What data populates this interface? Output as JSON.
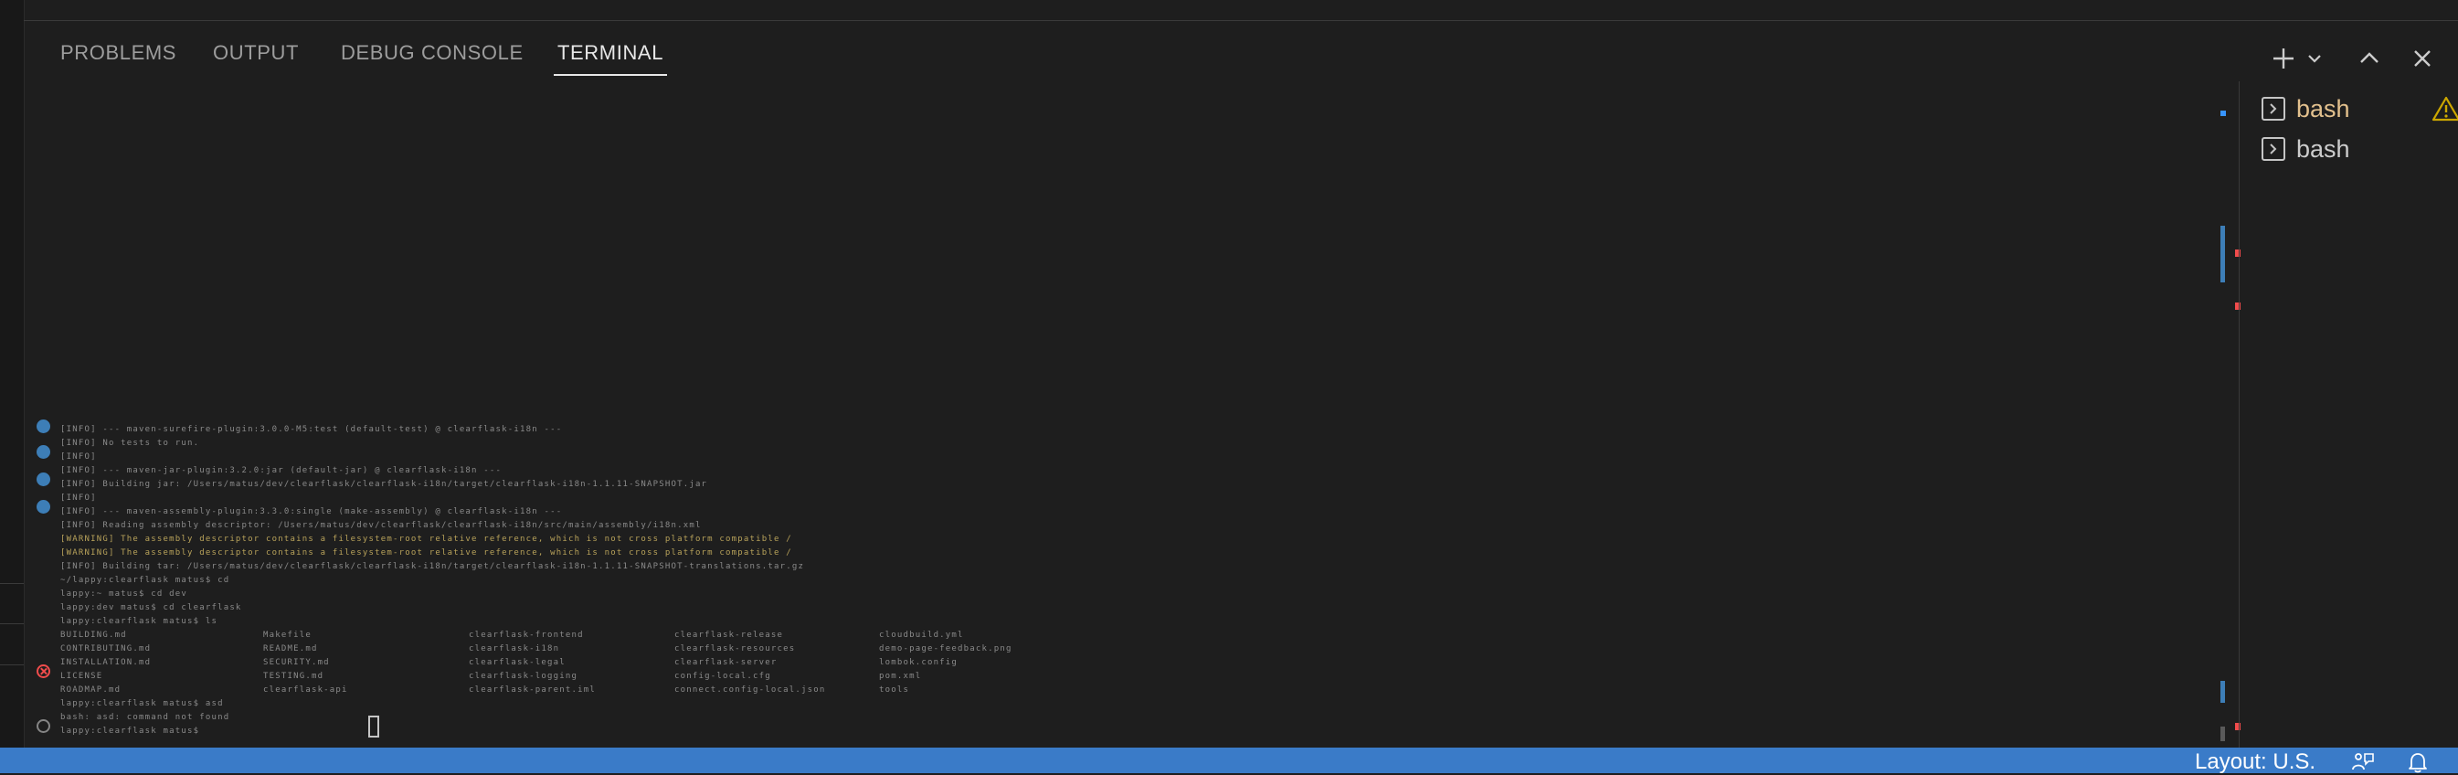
{
  "panel": {
    "tabs": [
      {
        "label": "PROBLEMS"
      },
      {
        "label": "OUTPUT"
      },
      {
        "label": "DEBUG CONSOLE"
      },
      {
        "label": "TERMINAL"
      }
    ],
    "active_tab": "TERMINAL",
    "actions": [
      "plus-icon",
      "chevron-down-icon",
      "chevron-up-icon",
      "close-icon"
    ]
  },
  "terminal": {
    "lines": [
      {
        "text": "[INFO] --- maven-surefire-plugin:3.0.0-M5:test (default-test) @ clearflask-i18n ---",
        "level": "info"
      },
      {
        "text": "[INFO] No tests to run.",
        "level": "info"
      },
      {
        "text": "[INFO]",
        "level": "info"
      },
      {
        "text": "[INFO] --- maven-jar-plugin:3.2.0:jar (default-jar) @ clearflask-i18n ---",
        "level": "info"
      },
      {
        "text": "[INFO] Building jar: /Users/matus/dev/clearflask/clearflask-i18n/target/clearflask-i18n-1.1.11-SNAPSHOT.jar",
        "level": "info"
      },
      {
        "text": "[INFO]",
        "level": "info"
      },
      {
        "text": "[INFO] --- maven-assembly-plugin:3.3.0:single (make-assembly) @ clearflask-i18n ---",
        "level": "info"
      },
      {
        "text": "[INFO] Reading assembly descriptor: /Users/matus/dev/clearflask/clearflask-i18n/src/main/assembly/i18n.xml",
        "level": "info"
      },
      {
        "text": "[WARNING] The assembly descriptor contains a filesystem-root relative reference, which is not cross platform compatible /",
        "level": "warn"
      },
      {
        "text": "[WARNING] The assembly descriptor contains a filesystem-root relative reference, which is not cross platform compatible /",
        "level": "warn"
      },
      {
        "text": "[INFO] Building tar: /Users/matus/dev/clearflask/clearflask-i18n/target/clearflask-i18n-1.1.11-SNAPSHOT-translations.tar.gz",
        "level": "info"
      },
      {
        "text": "~/lappy:clearflask matus$ cd",
        "level": "plain"
      },
      {
        "text": "lappy:~ matus$ cd dev",
        "level": "plain"
      },
      {
        "text": "lappy:dev matus$ cd clearflask",
        "level": "plain"
      },
      {
        "text": "lappy:clearflask matus$ ls",
        "level": "plain"
      },
      {
        "text": "BUILDING.md",
        "level": "plain"
      },
      {
        "text": "CONTRIBUTING.md",
        "level": "plain"
      },
      {
        "text": "INSTALLATION.md",
        "level": "plain"
      },
      {
        "text": "lappy:clearflask matus$ asd",
        "level": "plain"
      },
      {
        "text": "bash: asd: command not found",
        "level": "plain"
      },
      {
        "text": "lappy:clearflask matus$",
        "level": "plain"
      }
    ],
    "ls_grid": [
      [
        "BUILDING.md",
        "Makefile",
        "clearflask-frontend",
        "clearflask-release",
        "cloudbuild.yml"
      ],
      [
        "CONTRIBUTING.md",
        "README.md",
        "clearflask-i18n",
        "clearflask-resources",
        "demo-page-feedback.png"
      ],
      [
        "INSTALLATION.md",
        "SECURITY.md",
        "clearflask-legal",
        "clearflask-server",
        "lombok.config"
      ],
      [
        "LICENSE",
        "TESTING.md",
        "clearflask-logging",
        "config-local.cfg",
        "pom.xml"
      ],
      [
        "ROADMAP.md",
        "clearflask-api",
        "clearflask-parent.iml",
        "connect.config-local.json",
        "tools"
      ]
    ]
  },
  "terminal_tabs": [
    {
      "label": "bash",
      "icon": "terminal-icon",
      "highlight": true,
      "status_icon": "warning-icon"
    },
    {
      "label": "bash",
      "icon": "terminal-icon",
      "highlight": false
    }
  ],
  "statusbar": {
    "layout": "Layout: U.S.",
    "icons": [
      "feedback-icon",
      "bell-icon"
    ]
  },
  "colors": {
    "background": "#1e1e1e",
    "statusbar": "#3a7bc8",
    "tab_active": "#e7e7e7",
    "tab_inactive": "#9d9d9d",
    "highlight_tab": "#e2c08d",
    "warning": "#cca700",
    "error": "#f14c4c",
    "info_decoration": "#3d7eb7"
  }
}
